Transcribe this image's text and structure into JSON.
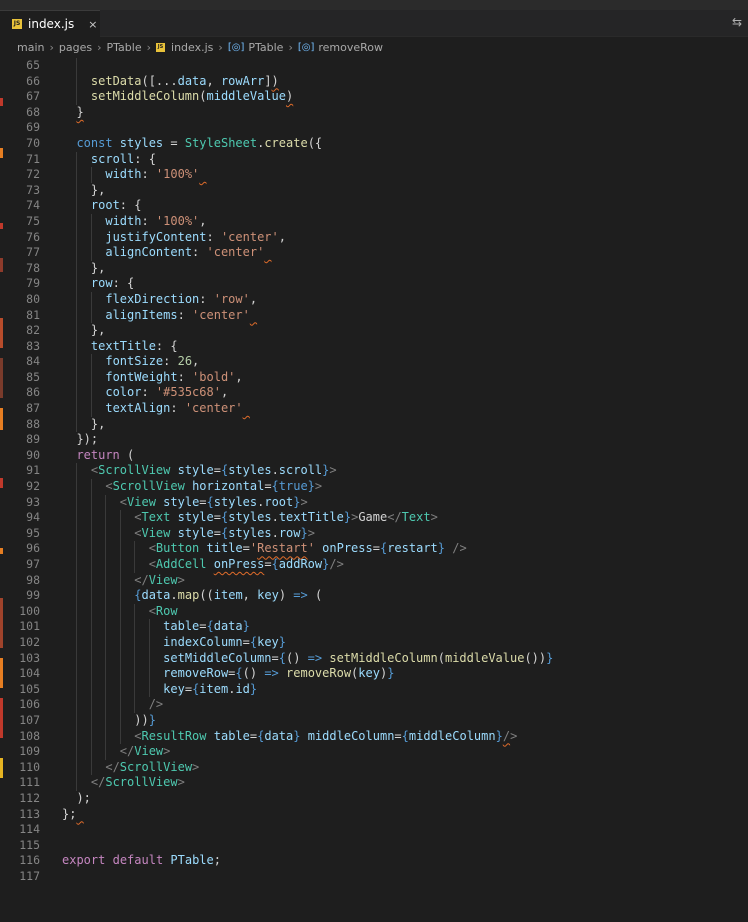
{
  "tab": {
    "icon": "JS",
    "title": "index.js",
    "close": "×",
    "action_icon": "compare-icon"
  },
  "breadcrumb": [
    {
      "label": "main",
      "kind": "folder"
    },
    {
      "label": "pages",
      "kind": "folder"
    },
    {
      "label": "PTable",
      "kind": "folder"
    },
    {
      "label": "index.js",
      "kind": "file"
    },
    {
      "label": "PTable",
      "kind": "symbol"
    },
    {
      "label": "removeRow",
      "kind": "symbol"
    }
  ],
  "code_lines": [
    {
      "n": "65",
      "indent": 2,
      "html": ""
    },
    {
      "n": "66",
      "indent": 2,
      "html": "<span class='fn'>setData</span>([...<span class='var'>data</span>, <span class='var'>rowArr</span>]<span class='squig'>)</span>"
    },
    {
      "n": "67",
      "indent": 2,
      "html": "<span class='fn'>setMiddleColumn</span>(<span class='var'>middleValue</span><span class='squig'>)</span>"
    },
    {
      "n": "68",
      "indent": 1,
      "html": "<span class='squig'>}</span>"
    },
    {
      "n": "69",
      "indent": 1,
      "html": ""
    },
    {
      "n": "70",
      "indent": 1,
      "html": "<span class='kwb'>const</span> <span class='var'>styles</span> = <span class='tag'>StyleSheet</span>.<span class='fn'>create</span>({"
    },
    {
      "n": "71",
      "indent": 2,
      "html": "<span class='prop'>scroll</span>: {"
    },
    {
      "n": "72",
      "indent": 3,
      "html": "<span class='prop'>width</span>: <span class='str'>'100%'</span><span class='squig'>&nbsp;</span>"
    },
    {
      "n": "73",
      "indent": 2,
      "html": "},"
    },
    {
      "n": "74",
      "indent": 2,
      "html": "<span class='prop'>root</span>: {"
    },
    {
      "n": "75",
      "indent": 3,
      "html": "<span class='prop'>width</span>: <span class='str'>'100%'</span>,"
    },
    {
      "n": "76",
      "indent": 3,
      "html": "<span class='prop'>justifyContent</span>: <span class='str'>'center'</span>,"
    },
    {
      "n": "77",
      "indent": 3,
      "html": "<span class='prop'>alignContent</span>: <span class='str'>'center'</span><span class='squig'>&nbsp;</span>"
    },
    {
      "n": "78",
      "indent": 2,
      "html": "},"
    },
    {
      "n": "79",
      "indent": 2,
      "html": "<span class='prop'>row</span>: {"
    },
    {
      "n": "80",
      "indent": 3,
      "html": "<span class='prop'>flexDirection</span>: <span class='str'>'row'</span>,"
    },
    {
      "n": "81",
      "indent": 3,
      "html": "<span class='prop'>alignItems</span>: <span class='str'>'center'</span><span class='squig'>&nbsp;</span>"
    },
    {
      "n": "82",
      "indent": 2,
      "html": "},"
    },
    {
      "n": "83",
      "indent": 2,
      "html": "<span class='prop'>textTitle</span>: {"
    },
    {
      "n": "84",
      "indent": 3,
      "html": "<span class='prop'>fontSize</span>: <span class='num'>26</span>,"
    },
    {
      "n": "85",
      "indent": 3,
      "html": "<span class='prop'>fontWeight</span>: <span class='str'>'bold'</span>,"
    },
    {
      "n": "86",
      "indent": 3,
      "html": "<span class='prop'>color</span>: <span class='str'>'#535c68'</span>,"
    },
    {
      "n": "87",
      "indent": 3,
      "html": "<span class='prop'>textAlign</span>: <span class='str'>'center'</span><span class='squig'>&nbsp;</span>"
    },
    {
      "n": "88",
      "indent": 2,
      "html": "},"
    },
    {
      "n": "89",
      "indent": 1,
      "html": "});"
    },
    {
      "n": "90",
      "indent": 1,
      "html": "<span class='kw'>return</span> ("
    },
    {
      "n": "91",
      "indent": 2,
      "html": "<span class='br'>&lt;</span><span class='tag'>ScrollView</span> <span class='attr'>style</span>=<span class='kwb'>{</span><span class='var'>styles</span>.<span class='var'>scroll</span><span class='kwb'>}</span><span class='br'>&gt;</span>"
    },
    {
      "n": "92",
      "indent": 3,
      "html": "<span class='br'>&lt;</span><span class='tag'>ScrollView</span> <span class='attr'>horizontal</span>=<span class='kwb'>{true}</span><span class='br'>&gt;</span>"
    },
    {
      "n": "93",
      "indent": 4,
      "html": "<span class='br'>&lt;</span><span class='tag'>View</span> <span class='attr'>style</span>=<span class='kwb'>{</span><span class='var'>styles</span>.<span class='var'>root</span><span class='kwb'>}</span><span class='br'>&gt;</span>"
    },
    {
      "n": "94",
      "indent": 5,
      "html": "<span class='br'>&lt;</span><span class='tag'>Text</span> <span class='attr'>style</span>=<span class='kwb'>{</span><span class='var'>styles</span>.<span class='var'>textTitle</span><span class='kwb'>}</span><span class='br'>&gt;</span>Game<span class='br'>&lt;/</span><span class='tag'>Text</span><span class='br'>&gt;</span>"
    },
    {
      "n": "95",
      "indent": 5,
      "html": "<span class='br'>&lt;</span><span class='tag'>View</span> <span class='attr'>style</span>=<span class='kwb'>{</span><span class='var'>styles</span>.<span class='var'>row</span><span class='kwb'>}</span><span class='br'>&gt;</span>"
    },
    {
      "n": "96",
      "indent": 6,
      "html": "<span class='br'>&lt;</span><span class='tag'>Button</span> <span class='attr'>title</span>=<span class='str'>'<span class=\"squig\">Restart</span>'</span> <span class='attr'>onPress</span>=<span class='kwb'>{</span><span class='var'>restart</span><span class='kwb'>}</span> <span class='br'>/&gt;</span>"
    },
    {
      "n": "97",
      "indent": 6,
      "html": "<span class='br'>&lt;</span><span class='tag'>AddCell</span> <span class='squig'><span class='attr'>onPress</span></span>=<span class='kwb'>{</span><span class='var'>addRow</span><span class='kwb'>}</span><span class='br'>/&gt;</span>"
    },
    {
      "n": "98",
      "indent": 5,
      "html": "<span class='br'>&lt;/</span><span class='tag'>View</span><span class='br'>&gt;</span>"
    },
    {
      "n": "99",
      "indent": 5,
      "html": "<span class='kwb'>{</span><span class='var'>data</span>.<span class='fn'>map</span>((<span class='var'>item</span>, <span class='var'>key</span>) <span class='kwb'>=&gt;</span> ("
    },
    {
      "n": "100",
      "indent": 6,
      "html": "<span class='br'>&lt;</span><span class='tag'>Row</span>"
    },
    {
      "n": "101",
      "indent": 7,
      "html": "<span class='attr'>table</span>=<span class='kwb'>{</span><span class='var'>data</span><span class='kwb'>}</span>"
    },
    {
      "n": "102",
      "indent": 7,
      "html": "<span class='attr'>indexColumn</span>=<span class='kwb'>{</span><span class='var'>key</span><span class='kwb'>}</span>"
    },
    {
      "n": "103",
      "indent": 7,
      "html": "<span class='attr'>setMiddleColumn</span>=<span class='kwb'>{</span>() <span class='kwb'>=&gt;</span> <span class='fn'>setMiddleColumn</span>(<span class='fn'>middleValue</span>())<span class='kwb'>}</span>"
    },
    {
      "n": "104",
      "indent": 7,
      "html": "<span class='attr'>removeRow</span>=<span class='kwb'>{</span>() <span class='kwb'>=&gt;</span> <span class='fn'>removeRow</span>(<span class='var'>key</span>)<span class='kwb'>}</span>"
    },
    {
      "n": "105",
      "indent": 7,
      "html": "<span class='attr'>key</span>=<span class='kwb'>{</span><span class='var'>item</span>.<span class='var'>id</span><span class='kwb'>}</span>"
    },
    {
      "n": "106",
      "indent": 6,
      "html": "<span class='br'>/&gt;</span>"
    },
    {
      "n": "107",
      "indent": 5,
      "html": "))<span class='kwb'>}</span>"
    },
    {
      "n": "108",
      "indent": 5,
      "html": "<span class='br'>&lt;</span><span class='tag'>ResultRow</span> <span class='attr'>table</span>=<span class='kwb'>{</span><span class='var'>data</span><span class='kwb'>}</span> <span class='attr'>middleColumn</span>=<span class='kwb'>{</span><span class='var'>middleColumn</span><span class='kwb'>}</span><span class='br'><span class='squig'>/</span>&gt;</span>"
    },
    {
      "n": "109",
      "indent": 4,
      "html": "<span class='br'>&lt;/</span><span class='tag'>View</span><span class='br'>&gt;</span>"
    },
    {
      "n": "110",
      "indent": 3,
      "html": "<span class='br'>&lt;/</span><span class='tag'>ScrollView</span><span class='br'>&gt;</span>"
    },
    {
      "n": "111",
      "indent": 2,
      "html": "<span class='br'>&lt;/</span><span class='tag'>ScrollView</span><span class='br'>&gt;</span>"
    },
    {
      "n": "112",
      "indent": 1,
      "html": ");"
    },
    {
      "n": "113",
      "indent": 0,
      "html": "};<span class='squig'>&nbsp;</span>"
    },
    {
      "n": "114",
      "indent": 0,
      "html": ""
    },
    {
      "n": "115",
      "indent": 0,
      "html": ""
    },
    {
      "n": "116",
      "indent": 0,
      "html": "<span class='kw'>export</span> <span class='kw'>default</span> <span class='var'>PTable</span>;"
    },
    {
      "n": "117",
      "indent": 0,
      "html": ""
    }
  ],
  "colors": {
    "background": "#1e1e1e",
    "keyword": "#c586c0",
    "string": "#ce9178",
    "function": "#dcdcaa",
    "tag": "#4ec9b0",
    "error": "#e06c2a"
  }
}
